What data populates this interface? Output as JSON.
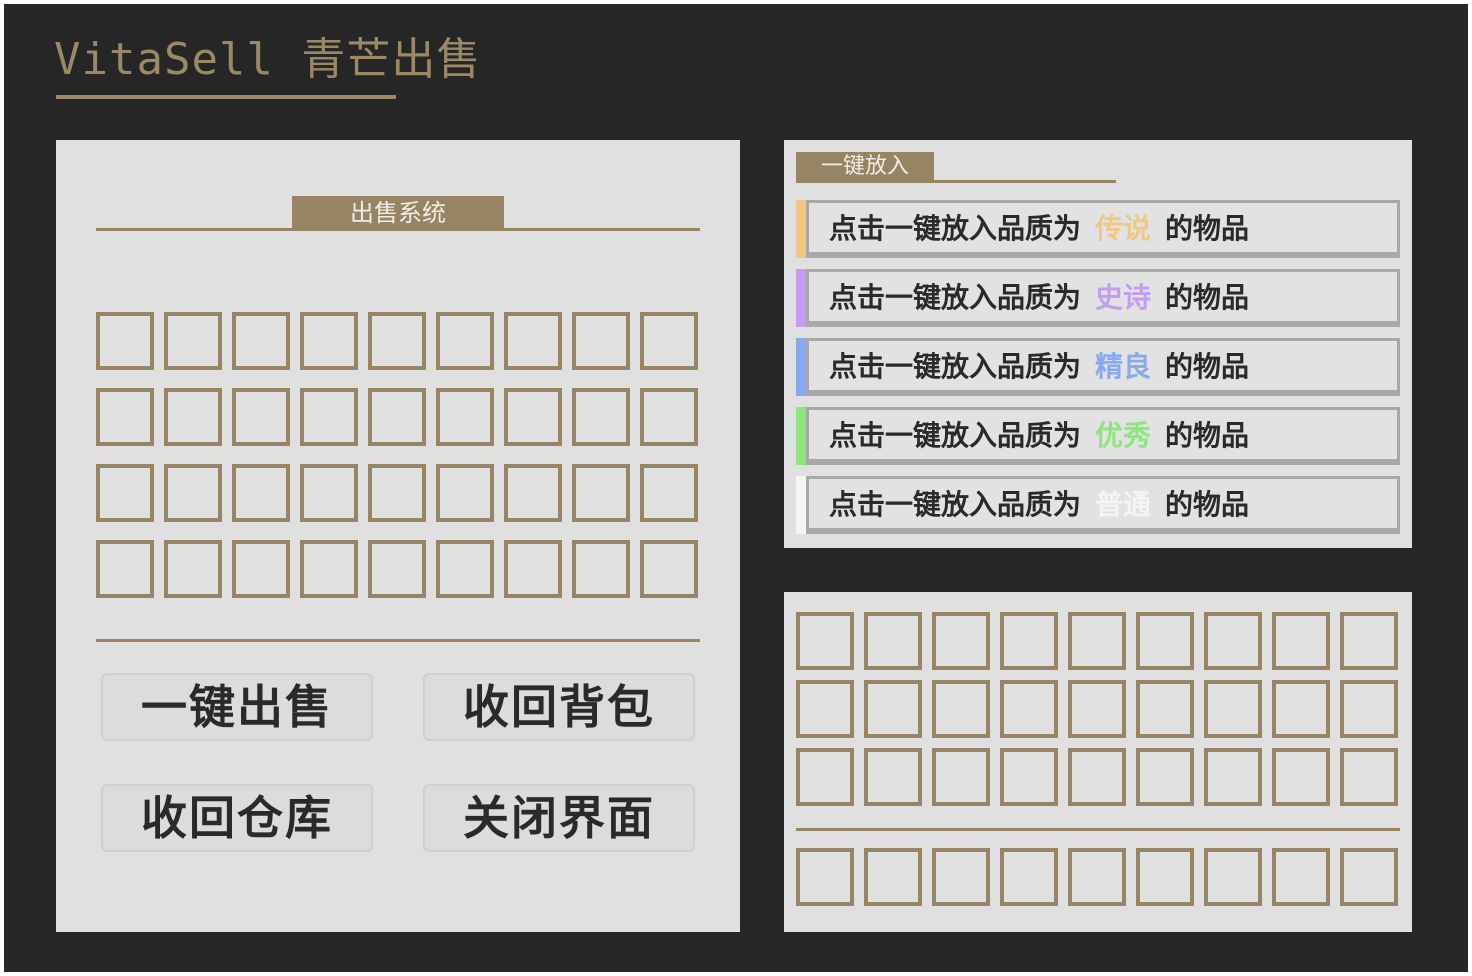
{
  "app": {
    "title": "VitaSell 青芒出售"
  },
  "sell_panel": {
    "header": "出售系统",
    "grid": {
      "rows": 4,
      "cols": 9
    },
    "buttons": [
      {
        "label": "一键出售"
      },
      {
        "label": "收回背包"
      },
      {
        "label": "收回仓库"
      },
      {
        "label": "关闭界面"
      }
    ]
  },
  "quick_panel": {
    "header": "一键放入",
    "rows": [
      {
        "prefix": "点击一键放入品质为",
        "quality": "传说",
        "suffix": "的物品",
        "color": "#f0c884"
      },
      {
        "prefix": "点击一键放入品质为",
        "quality": "史诗",
        "suffix": "的物品",
        "color": "#c49cf0"
      },
      {
        "prefix": "点击一键放入品质为",
        "quality": "精良",
        "suffix": "的物品",
        "color": "#88a8f0"
      },
      {
        "prefix": "点击一键放入品质为",
        "quality": "优秀",
        "suffix": "的物品",
        "color": "#8ce67c"
      },
      {
        "prefix": "点击一键放入品质为",
        "quality": "普通",
        "suffix": "的物品",
        "color": "#f4f4f4"
      }
    ]
  },
  "inventory_panel": {
    "main_grid": {
      "rows": 3,
      "cols": 9
    },
    "hotbar": {
      "rows": 1,
      "cols": 9
    }
  },
  "colors": {
    "background": "#262626",
    "panel": "#e0e0e0",
    "accent": "#978464",
    "title": "#9a8866"
  }
}
